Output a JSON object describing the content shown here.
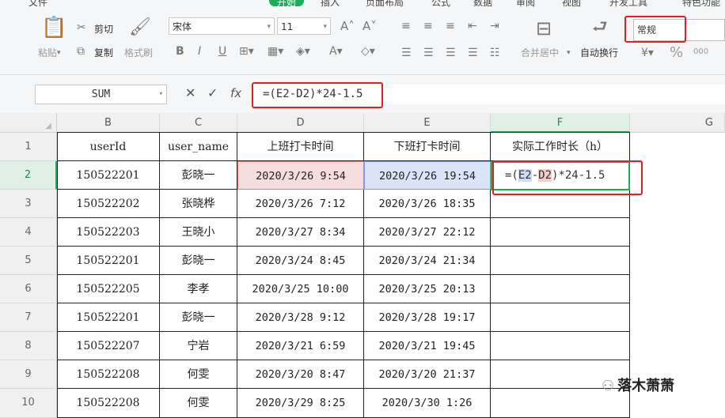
{
  "ribbon": {
    "tabs": [
      "文件",
      "开始",
      "插入",
      "页面布局",
      "公式",
      "数据",
      "审阅",
      "视图",
      "开发工具",
      "特色功能"
    ],
    "active_tab": "开始",
    "paste": "粘贴",
    "cut": "剪切",
    "copy": "复制",
    "format_painter": "格式刷",
    "font_name": "宋体",
    "font_size": "11",
    "merge_center": "合并居中",
    "wrap_text": "自动换行",
    "number_format": "常规",
    "percent": "%",
    "zeros": "000"
  },
  "formula_bar": {
    "name_box": "SUM",
    "fx": "fx",
    "formula": "=(E2-D2)*24-1.5"
  },
  "grid": {
    "columns": [
      "B",
      "C",
      "D",
      "E",
      "F",
      "G"
    ],
    "rows": [
      "1",
      "2",
      "3",
      "4",
      "5",
      "6",
      "7",
      "8",
      "9",
      "10"
    ],
    "headers": [
      "userId",
      "user_name",
      "上班打卡时间",
      "下班打卡时间",
      "实际工作时长（h）"
    ],
    "data": [
      [
        "150522201",
        "彭晓一",
        "2020/3/26 9:54",
        "2020/3/26 19:54"
      ],
      [
        "150522202",
        "张晓桦",
        "2020/3/26 7:12",
        "2020/3/26 18:35"
      ],
      [
        "150522203",
        "王晓小",
        "2020/3/27 8:34",
        "2020/3/27 22:12"
      ],
      [
        "150522201",
        "彭晓一",
        "2020/3/24 8:45",
        "2020/3/24 21:34"
      ],
      [
        "150522205",
        "李孝",
        "2020/3/25 10:00",
        "2020/3/25 20:13"
      ],
      [
        "150522201",
        "彭晓一",
        "2020/3/28 9:12",
        "2020/3/28 19:17"
      ],
      [
        "150522207",
        "宁岩",
        "2020/3/21 6:59",
        "2020/3/21 19:45"
      ],
      [
        "150522208",
        "何雯",
        "2020/3/20 8:47",
        "2020/3/20 21:37"
      ],
      [
        "150522208",
        "何雯",
        "2020/3/29 8:25",
        "2020/3/30 1:26"
      ]
    ],
    "editing_cell": {
      "prefix": "=(",
      "ref1": "E2",
      "minus": "-",
      "ref2": "D2",
      "suffix": ")*24-1.5"
    }
  },
  "watermark": "落木萧萧",
  "colors": {
    "accent": "#1aad5b",
    "annotation_red": "#e02020",
    "ref_blue": "#cfdcf7",
    "ref_red": "#f4cccc"
  }
}
